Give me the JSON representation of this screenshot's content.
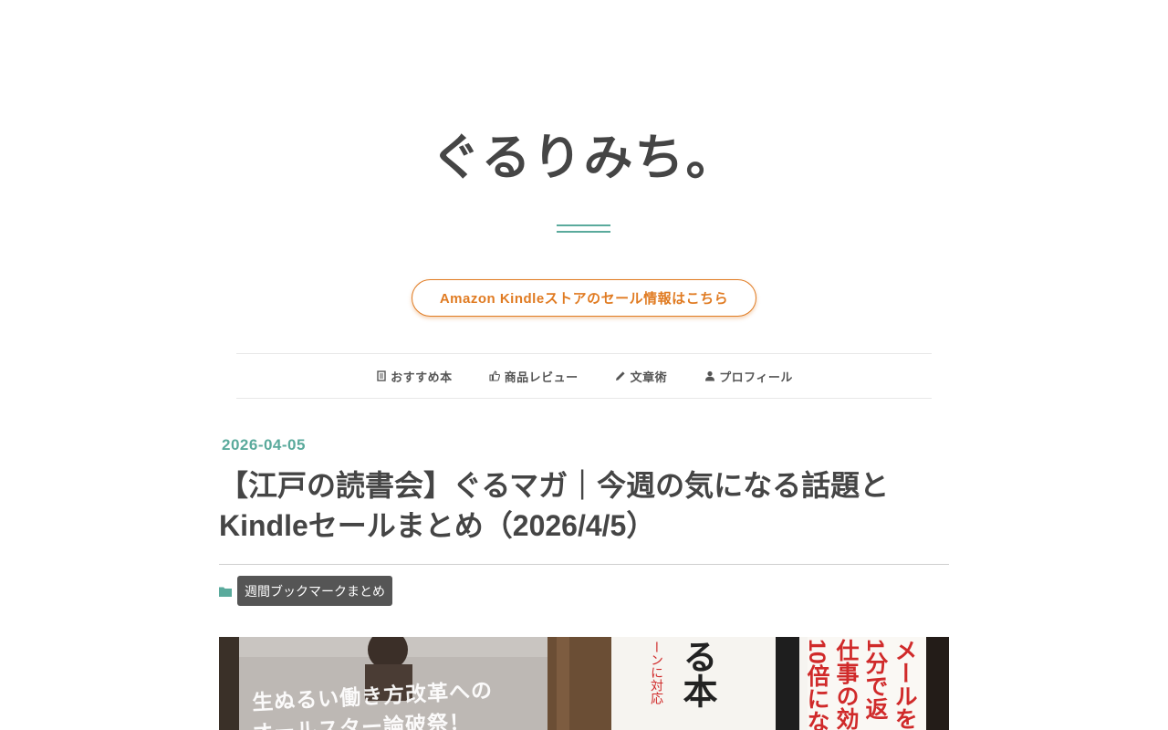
{
  "site": {
    "title": "ぐるりみち。"
  },
  "sale_banner": {
    "label": "Amazon Kindleストアのセール情報はこちら",
    "color": "#e07b22"
  },
  "nav": {
    "items": [
      {
        "label": "おすすめ本",
        "icon": "book-icon"
      },
      {
        "label": "商品レビュー",
        "icon": "thumbs-up-icon"
      },
      {
        "label": "文章術",
        "icon": "pencil-icon"
      },
      {
        "label": "プロフィール",
        "icon": "user-icon"
      }
    ]
  },
  "post": {
    "date": "2026-04-05",
    "title": "【江戸の読書会】ぐるマガ｜今週の気になる話題とKindleセールまとめ（2026/4/5）",
    "category": "週間ブックマークまとめ",
    "accent_color": "#5aaa9c"
  },
  "hero": {
    "cover_left_line1": "生ぬるい働き方改革への",
    "cover_left_line2": "オールスター論破祭！",
    "cover_mid_vertical": "る本",
    "cover_mid_small": "ーンに対応",
    "cover_right_lines": [
      "メールを",
      "1分で返",
      "仕事の効",
      "10倍にな"
    ]
  }
}
